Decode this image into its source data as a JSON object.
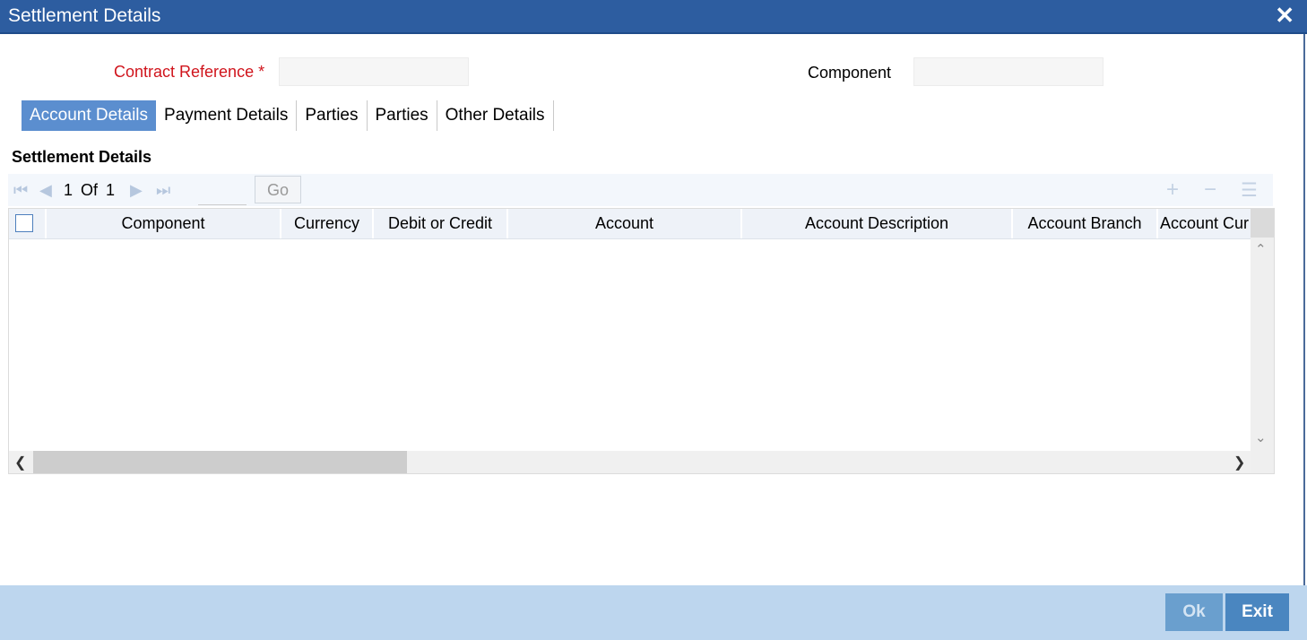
{
  "window": {
    "title": "Settlement Details",
    "close_label": "✕"
  },
  "form": {
    "contract_reference_label": "Contract Reference",
    "required_marker": "*",
    "contract_reference_value": "",
    "component_label": "Component",
    "component_value": ""
  },
  "tabs": [
    {
      "label": "Account Details",
      "active": true
    },
    {
      "label": "Payment Details",
      "active": false
    },
    {
      "label": "Parties",
      "active": false
    },
    {
      "label": "Parties",
      "active": false
    },
    {
      "label": "Other Details",
      "active": false
    }
  ],
  "section": {
    "title": "Settlement Details"
  },
  "pager": {
    "current": "1",
    "of_label": "Of",
    "total": "1",
    "page_input_value": "",
    "go_label": "Go"
  },
  "grid": {
    "columns": [
      "Component",
      "Currency",
      "Debit or Credit",
      "Account",
      "Account Description",
      "Account Branch",
      "Account Cur"
    ],
    "rows": []
  },
  "footer": {
    "ok_label": "Ok",
    "exit_label": "Exit"
  },
  "colors": {
    "title_bar": "#2d5da0",
    "active_tab": "#5b8ecf",
    "required_label": "#d0141c",
    "footer": "#bdd6ee"
  }
}
